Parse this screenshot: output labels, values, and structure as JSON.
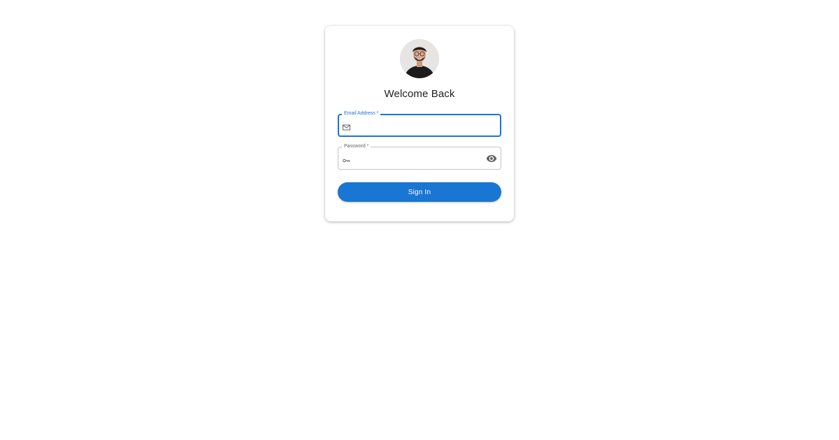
{
  "login": {
    "title": "Welcome Back",
    "email": {
      "label": "Email Address *",
      "value": "",
      "icon": "mail-icon"
    },
    "password": {
      "label": "Password *",
      "value": "",
      "icon": "key-icon",
      "toggle_icon": "eye-icon"
    },
    "submit_label": "Sign In"
  },
  "colors": {
    "primary": "#1976d2",
    "outline": "#c4c4c4",
    "label_muted": "#666666",
    "background": "#ffffff"
  }
}
